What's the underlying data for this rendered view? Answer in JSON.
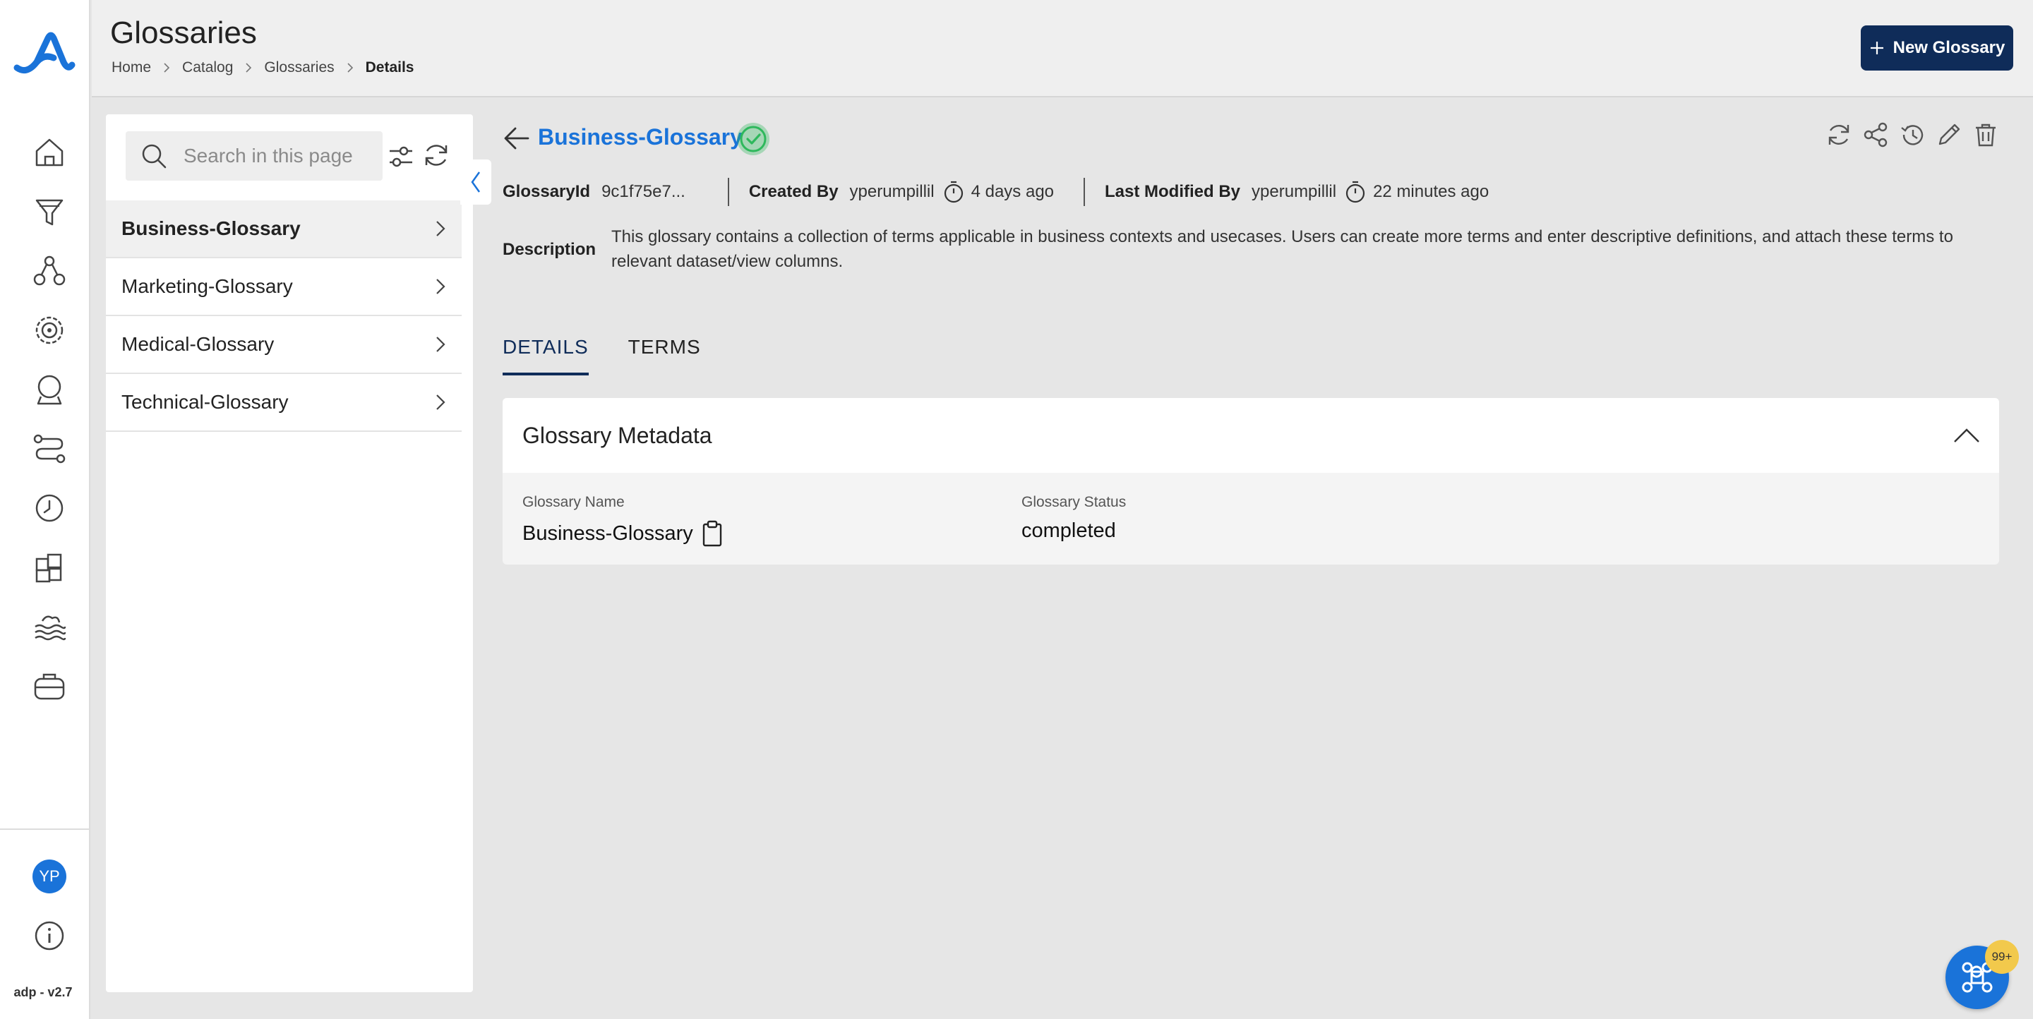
{
  "app": {
    "version": "adp - v2.7",
    "user_initials": "YP"
  },
  "header": {
    "title": "Glossaries",
    "breadcrumb": [
      "Home",
      "Catalog",
      "Glossaries",
      "Details"
    ],
    "new_button": "New Glossary"
  },
  "rail_icons": [
    "home-icon",
    "filter-funnel-icon",
    "network-icon",
    "target-icon",
    "crystal-ball-icon",
    "pipeline-icon",
    "clock-icon",
    "puzzle-icon",
    "waves-icon",
    "briefcase-icon",
    "info-icon"
  ],
  "sidebar": {
    "search_placeholder": "Search in this page",
    "items": [
      {
        "label": "Business-Glossary",
        "active": true
      },
      {
        "label": "Marketing-Glossary",
        "active": false
      },
      {
        "label": "Medical-Glossary",
        "active": false
      },
      {
        "label": "Technical-Glossary",
        "active": false
      }
    ]
  },
  "detail": {
    "title": "Business-Glossary",
    "glossary_id_label": "GlossaryId",
    "glossary_id": "9c1f75e7...",
    "created_by_label": "Created By",
    "created_by": "yperumpillil",
    "created_ago": "4 days ago",
    "modified_by_label": "Last Modified By",
    "modified_by": "yperumpillil",
    "modified_ago": "22 minutes ago",
    "description_label": "Description",
    "description": "This glossary contains a collection of terms applicable in business contexts and usecases. Users can create more terms and enter descriptive definitions, and attach these terms to relevant dataset/view columns.",
    "tabs": [
      "DETAILS",
      "TERMS"
    ],
    "active_tab": "DETAILS"
  },
  "metadata": {
    "title": "Glossary Metadata",
    "name_label": "Glossary Name",
    "name_value": "Business-Glossary",
    "status_label": "Glossary Status",
    "status_value": "completed"
  },
  "fab": {
    "badge": "99+"
  },
  "colors": {
    "primary": "#0f2c59",
    "accent": "#1a73d9",
    "success": "#2eb85c",
    "badge": "#f2c94c"
  }
}
